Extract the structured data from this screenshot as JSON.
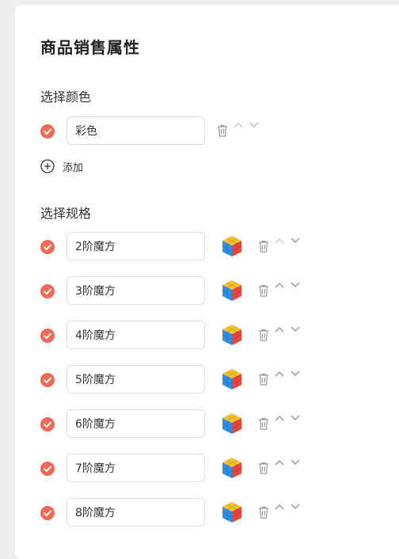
{
  "page": {
    "title": "商品销售属性"
  },
  "color_section": {
    "label": "选择颜色",
    "items": [
      {
        "value": "彩色",
        "checked": true
      }
    ],
    "add_label": "添加"
  },
  "spec_section": {
    "label": "选择规格",
    "items": [
      {
        "value": "2阶魔方",
        "checked": true,
        "thumb_icon": "rubiks-cube-2x2-image"
      },
      {
        "value": "3阶魔方",
        "checked": true,
        "thumb_icon": "rubiks-cube-3x3-image"
      },
      {
        "value": "4阶魔方",
        "checked": true,
        "thumb_icon": "rubiks-cube-4x4-image"
      },
      {
        "value": "5阶魔方",
        "checked": true,
        "thumb_icon": "rubiks-cube-5x5-image"
      },
      {
        "value": "6阶魔方",
        "checked": true,
        "thumb_icon": "rubiks-cube-6x6-image"
      },
      {
        "value": "7阶魔方",
        "checked": true,
        "thumb_icon": "rubiks-cube-7x7-image"
      },
      {
        "value": "8阶魔方",
        "checked": true,
        "thumb_icon": "rubiks-cube-8x8-image"
      }
    ]
  },
  "colors": {
    "accent": "#ee6a55",
    "icon_gray": "#999999",
    "arrow_gray": "#bbbbbb"
  }
}
